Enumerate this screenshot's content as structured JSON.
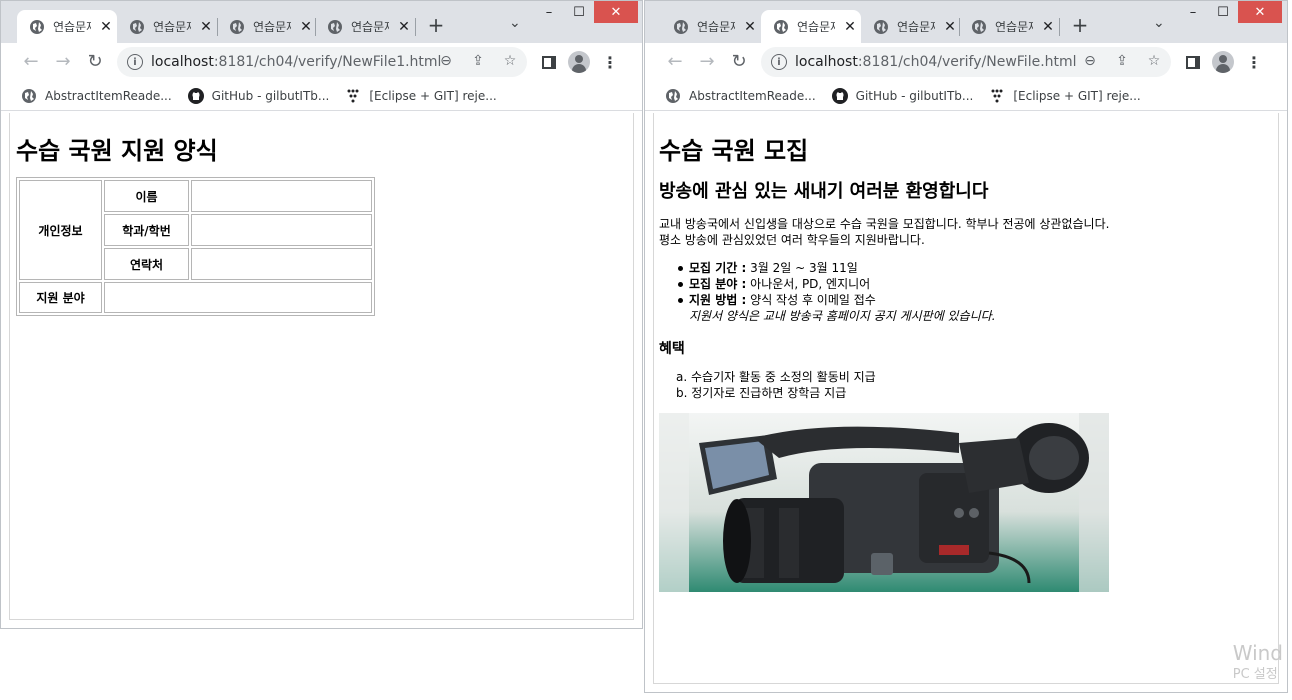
{
  "left": {
    "tabs": [
      {
        "title": "연습문제",
        "close": "✕"
      },
      {
        "title": "연습문제",
        "close": "✕"
      },
      {
        "title": "연습문제",
        "close": "✕"
      },
      {
        "title": "연습문제",
        "close": "✕"
      }
    ],
    "url_host": "localhost",
    "url_path": ":8181/ch04/verify/NewFile1.html",
    "bookmarks": [
      {
        "label": "AbstractItemReade..."
      },
      {
        "label": "GitHub - gilbutITb..."
      },
      {
        "label": "[Eclipse + GIT] reje..."
      }
    ],
    "page": {
      "title": "수습 국원 지원 양식",
      "table": {
        "group_label": "개인정보",
        "rows": [
          "이름",
          "학과/학번",
          "연락처"
        ],
        "field_label": "지원 분야"
      }
    }
  },
  "right": {
    "tabs": [
      {
        "title": "연습문제",
        "close": "✕"
      },
      {
        "title": "연습문제",
        "close": "✕"
      },
      {
        "title": "연습문제",
        "close": "✕"
      },
      {
        "title": "연습문제",
        "close": "✕"
      }
    ],
    "url_host": "localhost",
    "url_path": ":8181/ch04/verify/NewFile.html",
    "bookmarks": [
      {
        "label": "AbstractItemReade..."
      },
      {
        "label": "GitHub - gilbutITb..."
      },
      {
        "label": "[Eclipse + GIT] reje..."
      }
    ],
    "page": {
      "h1": "수습 국원 모집",
      "h2": "방송에 관심 있는 새내기 여러분 환영합니다",
      "intro_line1": "교내 방송국에서 신입생을 대상으로 수습 국원을 모집합니다. 학부나 전공에 상관없습니다.",
      "intro_line2": "평소 방송에 관심있었던 여러 학우들의 지원바랍니다.",
      "list": [
        {
          "label": "모집 기간 :",
          "value": "3월 2일 ~ 3월 11일"
        },
        {
          "label": "모집 분야 :",
          "value": "아나운서, PD, 엔지니어"
        },
        {
          "label": "지원 방법 :",
          "value": "양식 작성 후 이메일 접수"
        }
      ],
      "note": "지원서 양식은 교내 방송국 홈페이지 공지 게시판에 있습니다.",
      "benefits_title": "혜택",
      "benefits": [
        {
          "marker": "a.",
          "text": "수습기자 활동 중 소정의 활동비 지급"
        },
        {
          "marker": "b.",
          "text": "정기자로 진급하면 장학금 지급"
        }
      ]
    }
  },
  "watermark": {
    "line1": "Wind",
    "line2": "PC 설정"
  },
  "colors": {
    "close_button": "#d9534f",
    "tab_strip": "#dee1e6",
    "omnibox": "#f1f3f4"
  }
}
